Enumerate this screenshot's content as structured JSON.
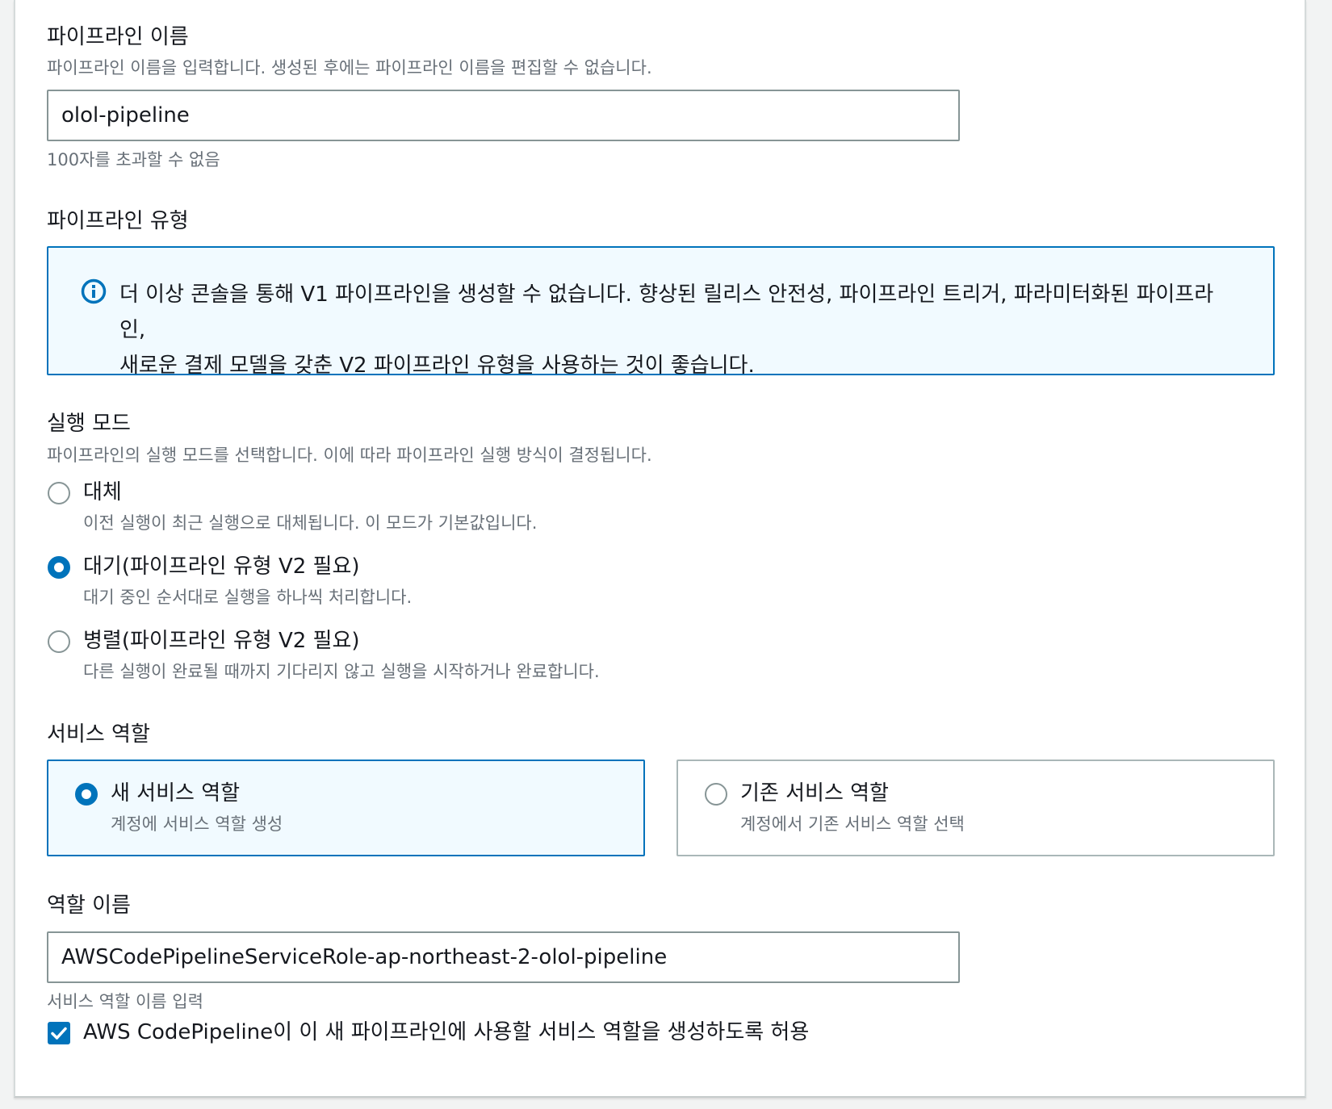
{
  "pipeline_name": {
    "label": "파이프라인 이름",
    "description": "파이프라인 이름을 입력합니다. 생성된 후에는 파이프라인 이름을 편집할 수 없습니다.",
    "value": "olol-pipeline",
    "constraint": "100자를 초과할 수 없음"
  },
  "pipeline_type": {
    "label": "파이프라인 유형",
    "alert_icon": "info-icon",
    "alert_line1": "더 이상 콘솔을 통해 V1 파이프라인을 생성할 수 없습니다. 향상된 릴리스 안전성, 파이프라인 트리거, 파라미터화된 파이프라인,",
    "alert_line2": "새로운 결제 모델을 갖춘 V2 파이프라인 유형을 사용하는 것이 좋습니다."
  },
  "execution_mode": {
    "label": "실행 모드",
    "description": "파이프라인의 실행 모드를 선택합니다. 이에 따라 파이프라인 실행 방식이 결정됩니다.",
    "selected": "queued",
    "options": [
      {
        "id": "superseded",
        "title": "대체",
        "description": "이전 실행이 최근 실행으로 대체됩니다. 이 모드가 기본값입니다."
      },
      {
        "id": "queued",
        "title": "대기(파이프라인 유형 V2 필요)",
        "description": "대기 중인 순서대로 실행을 하나씩 처리합니다."
      },
      {
        "id": "parallel",
        "title": "병렬(파이프라인 유형 V2 필요)",
        "description": "다른 실행이 완료될 때까지 기다리지 않고 실행을 시작하거나 완료합니다."
      }
    ]
  },
  "service_role": {
    "label": "서비스 역할",
    "selected": "new",
    "options": [
      {
        "id": "new",
        "title": "새 서비스 역할",
        "description": "계정에 서비스 역할 생성"
      },
      {
        "id": "existing",
        "title": "기존 서비스 역할",
        "description": "계정에서 기존 서비스 역할 선택"
      }
    ]
  },
  "role_name": {
    "label": "역할 이름",
    "value": "AWSCodePipelineServiceRole-ap-northeast-2-olol-pipeline",
    "hint": "서비스 역할 이름 입력",
    "checkbox_label": "AWS CodePipeline이 이 새 파이프라인에 사용할 서비스 역할을 생성하도록 허용",
    "checkbox_checked": true
  },
  "colors": {
    "accent": "#0073bb",
    "alert_background": "#f1faff",
    "text": "#16191f",
    "muted_text": "#687078"
  }
}
